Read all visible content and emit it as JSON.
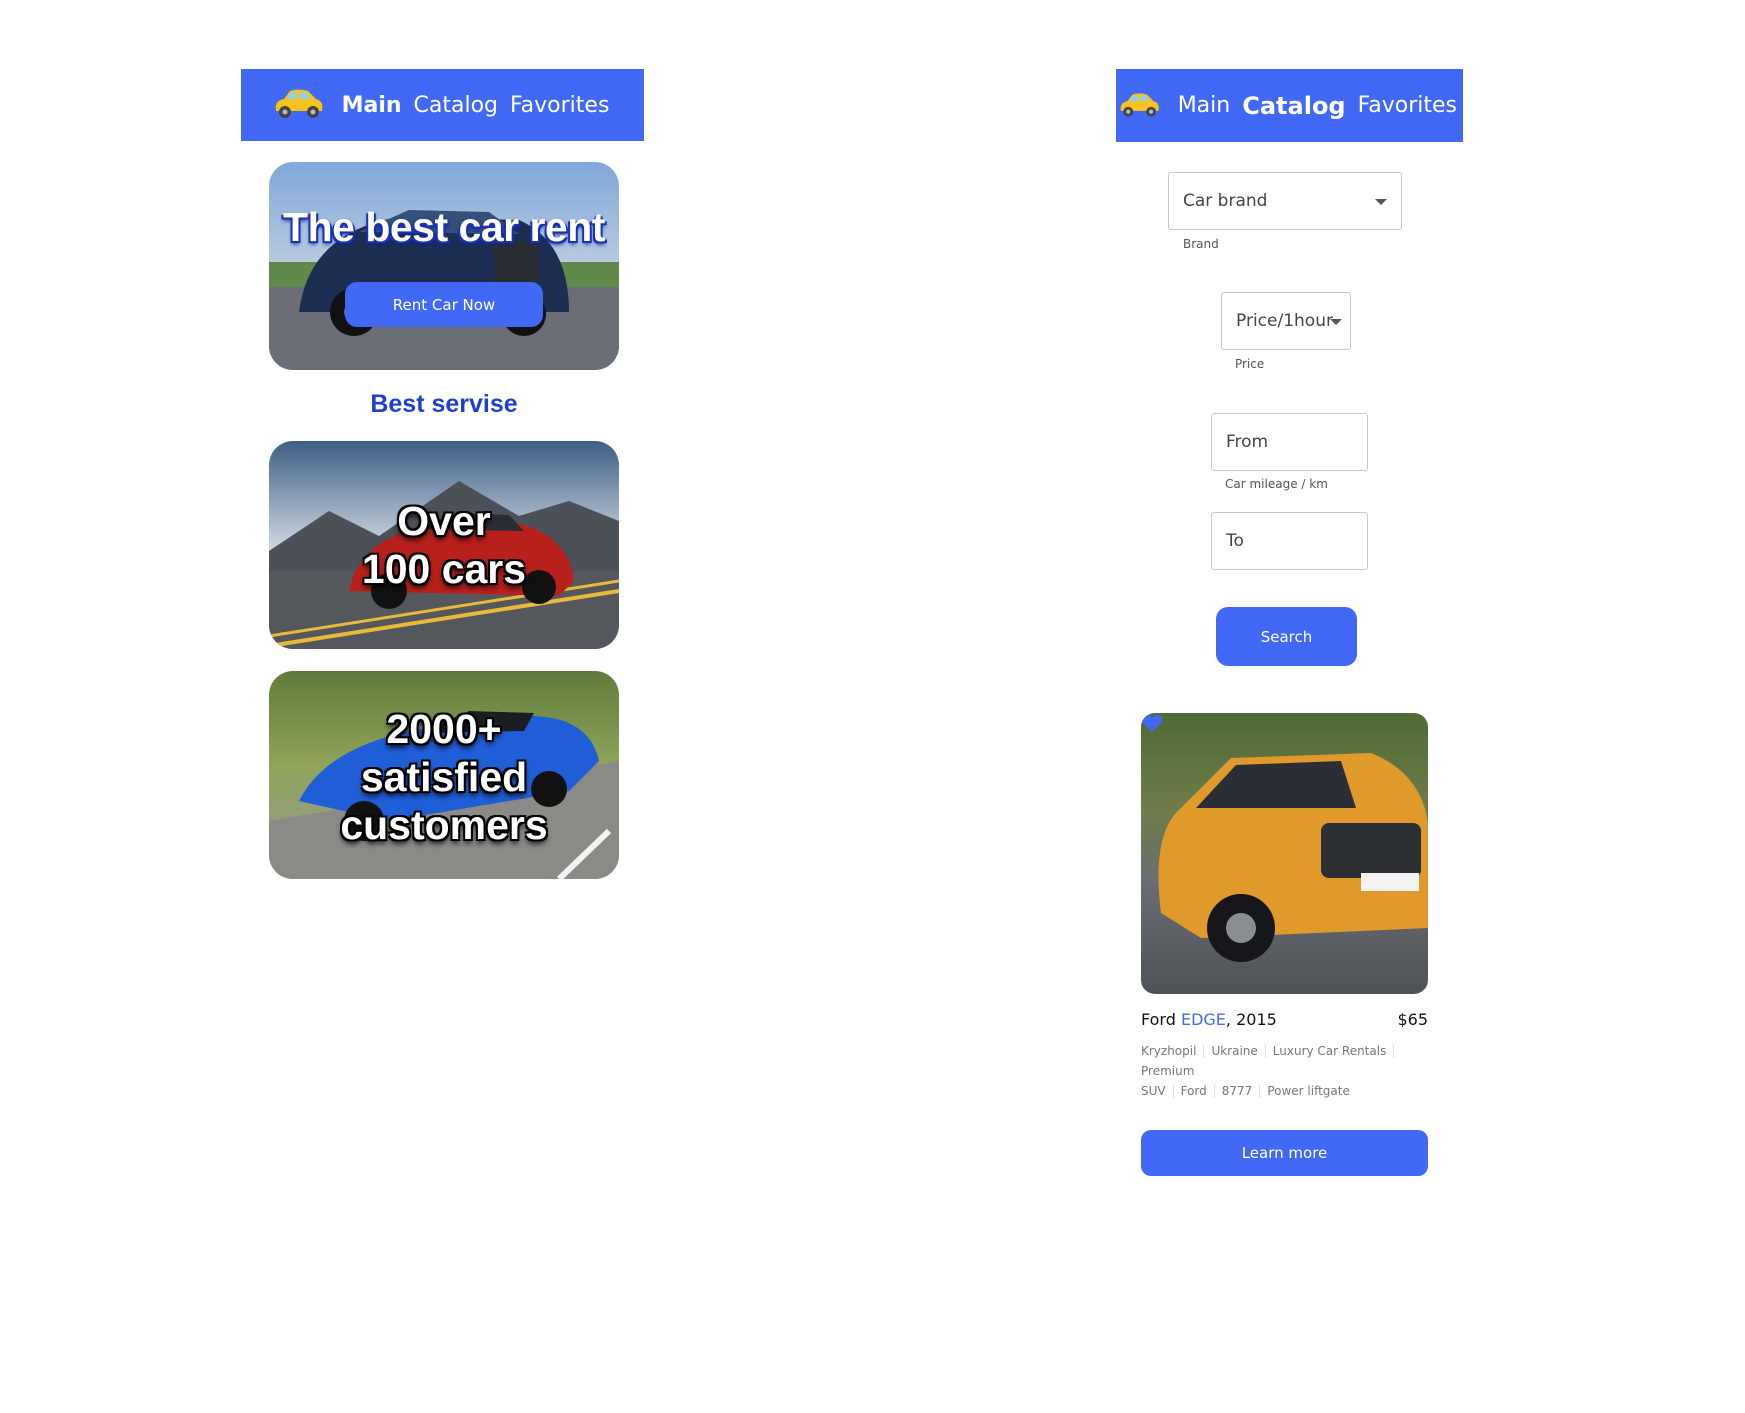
{
  "nav": {
    "links": [
      "Main",
      "Catalog",
      "Favorites"
    ],
    "logo_icon": "yellow-car-icon"
  },
  "home": {
    "hero_title": "The best car rent",
    "rent_button": "Rent Car Now",
    "section_title": "Best servise",
    "cars_line1": "Over",
    "cars_line2": "100 cars",
    "customers_line1": "2000+",
    "customers_line2": "satisfied",
    "customers_line3": "customers"
  },
  "catalog": {
    "brand_select_value": "Car brand",
    "brand_caption": "Brand",
    "price_select_value": "Price/1hour",
    "price_caption": "Price",
    "from_placeholder": "From",
    "mileage_caption": "Car mileage / km",
    "to_placeholder": "To",
    "search_button": "Search",
    "car": {
      "make": "Ford",
      "model": "EDGE",
      "year_suffix": ", 2015",
      "price": "$65",
      "city": "Kryzhopil",
      "country": "Ukraine",
      "company": "Luxury Car Rentals",
      "class": "Premium",
      "type": "SUV",
      "brand": "Ford",
      "id": "8777",
      "feature": "Power liftgate",
      "favorite": true
    },
    "learn_more_button": "Learn more"
  },
  "colors": {
    "accent": "#4169f5",
    "title_blue": "#1f3fcf"
  }
}
